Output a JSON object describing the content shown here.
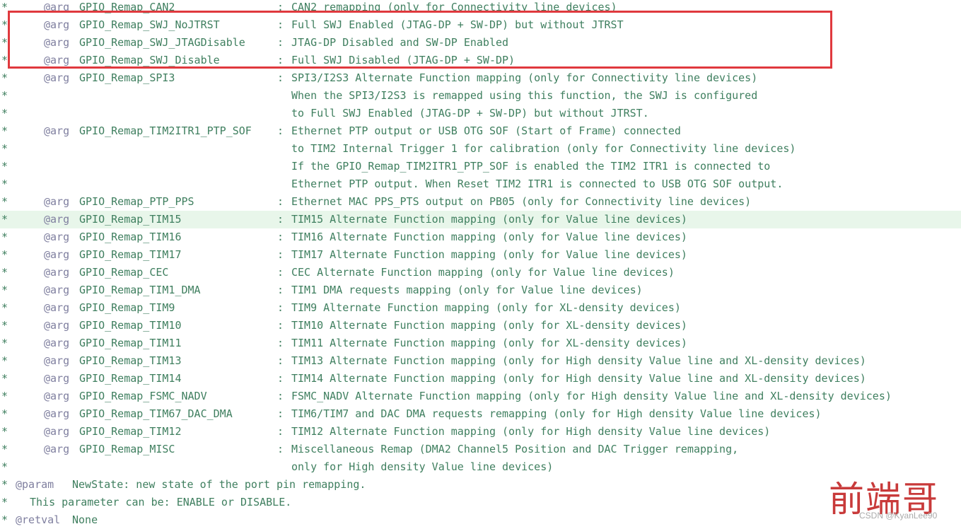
{
  "lines": [
    {
      "kind": "arg",
      "at": "@arg",
      "name": "GPIO_Remap_CAN2",
      "desc": "CAN2 remapping (only for Connectivity line devices)"
    },
    {
      "kind": "arg",
      "at": "@arg",
      "name": "GPIO_Remap_SWJ_NoJTRST",
      "desc": "Full SWJ Enabled (JTAG-DP + SW-DP) but without JTRST"
    },
    {
      "kind": "arg",
      "at": "@arg",
      "name": "GPIO_Remap_SWJ_JTAGDisable",
      "desc": "JTAG-DP Disabled and SW-DP Enabled"
    },
    {
      "kind": "arg",
      "at": "@arg",
      "name": "GPIO_Remap_SWJ_Disable",
      "desc": "Full SWJ Disabled (JTAG-DP + SW-DP)"
    },
    {
      "kind": "arg",
      "at": "@arg",
      "name": "GPIO_Remap_SPI3",
      "desc": "SPI3/I2S3 Alternate Function mapping (only for Connectivity line devices)"
    },
    {
      "kind": "cont",
      "desc": "When the SPI3/I2S3 is remapped using this function, the SWJ is configured"
    },
    {
      "kind": "cont",
      "desc": "to Full SWJ Enabled (JTAG-DP + SW-DP) but without JTRST."
    },
    {
      "kind": "arg",
      "at": "@arg",
      "name": "GPIO_Remap_TIM2ITR1_PTP_SOF",
      "desc": "Ethernet PTP output or USB OTG SOF (Start of Frame) connected"
    },
    {
      "kind": "cont",
      "desc": "to TIM2 Internal Trigger 1 for calibration (only for Connectivity line devices)"
    },
    {
      "kind": "cont",
      "desc": "If the GPIO_Remap_TIM2ITR1_PTP_SOF is enabled the TIM2 ITR1 is connected to"
    },
    {
      "kind": "cont",
      "desc": "Ethernet PTP output. When Reset TIM2 ITR1 is connected to USB OTG SOF output."
    },
    {
      "kind": "arg",
      "at": "@arg",
      "name": "GPIO_Remap_PTP_PPS",
      "desc": "Ethernet MAC PPS_PTS output on PB05 (only for Connectivity line devices)"
    },
    {
      "kind": "arg",
      "at": "@arg",
      "name": "GPIO_Remap_TIM15",
      "desc": "TIM15 Alternate Function mapping (only for Value line devices)",
      "highlight": true
    },
    {
      "kind": "arg",
      "at": "@arg",
      "name": "GPIO_Remap_TIM16",
      "desc": "TIM16 Alternate Function mapping (only for Value line devices)"
    },
    {
      "kind": "arg",
      "at": "@arg",
      "name": "GPIO_Remap_TIM17",
      "desc": "TIM17 Alternate Function mapping (only for Value line devices)"
    },
    {
      "kind": "arg",
      "at": "@arg",
      "name": "GPIO_Remap_CEC",
      "desc": "CEC Alternate Function mapping (only for Value line devices)"
    },
    {
      "kind": "arg",
      "at": "@arg",
      "name": "GPIO_Remap_TIM1_DMA",
      "desc": "TIM1 DMA requests mapping (only for Value line devices)"
    },
    {
      "kind": "arg",
      "at": "@arg",
      "name": "GPIO_Remap_TIM9",
      "desc": "TIM9 Alternate Function mapping (only for XL-density devices)"
    },
    {
      "kind": "arg",
      "at": "@arg",
      "name": "GPIO_Remap_TIM10",
      "desc": "TIM10 Alternate Function mapping (only for XL-density devices)"
    },
    {
      "kind": "arg",
      "at": "@arg",
      "name": "GPIO_Remap_TIM11",
      "desc": "TIM11 Alternate Function mapping (only for XL-density devices)"
    },
    {
      "kind": "arg",
      "at": "@arg",
      "name": "GPIO_Remap_TIM13",
      "desc": "TIM13 Alternate Function mapping (only for High density Value line and XL-density devices)"
    },
    {
      "kind": "arg",
      "at": "@arg",
      "name": "GPIO_Remap_TIM14",
      "desc": "TIM14 Alternate Function mapping (only for High density Value line and XL-density devices)"
    },
    {
      "kind": "arg",
      "at": "@arg",
      "name": "GPIO_Remap_FSMC_NADV",
      "desc": "FSMC_NADV Alternate Function mapping (only for High density Value line and XL-density devices)"
    },
    {
      "kind": "arg",
      "at": "@arg",
      "name": "GPIO_Remap_TIM67_DAC_DMA",
      "desc": "TIM6/TIM7 and DAC DMA requests remapping (only for High density Value line devices)"
    },
    {
      "kind": "arg",
      "at": "@arg",
      "name": "GPIO_Remap_TIM12",
      "desc": "TIM12 Alternate Function mapping (only for High density Value line devices)"
    },
    {
      "kind": "arg",
      "at": "@arg",
      "name": "GPIO_Remap_MISC",
      "desc": "Miscellaneous Remap (DMA2 Channel5 Position and DAC Trigger remapping,"
    },
    {
      "kind": "cont",
      "desc": "only for High density Value line devices)"
    },
    {
      "kind": "param",
      "tag": "@param",
      "text": "NewState: new state of the port pin remapping."
    },
    {
      "kind": "plain",
      "text": "This parameter can be: ENABLE or DISABLE."
    },
    {
      "kind": "retval",
      "tag": "@retval",
      "text": "None"
    }
  ],
  "comment_marker": "*",
  "colon": ":",
  "watermark": {
    "chinese": "前端哥",
    "csdn": "CSDN @KyanLee90"
  },
  "colors": {
    "comment_text": "#3f7f5f",
    "doc_tag": "#7f7f9f",
    "highlight_bg": "#e8f6ea",
    "annotation_box": "#e0393e",
    "watermark_red": "#c83a3a"
  }
}
